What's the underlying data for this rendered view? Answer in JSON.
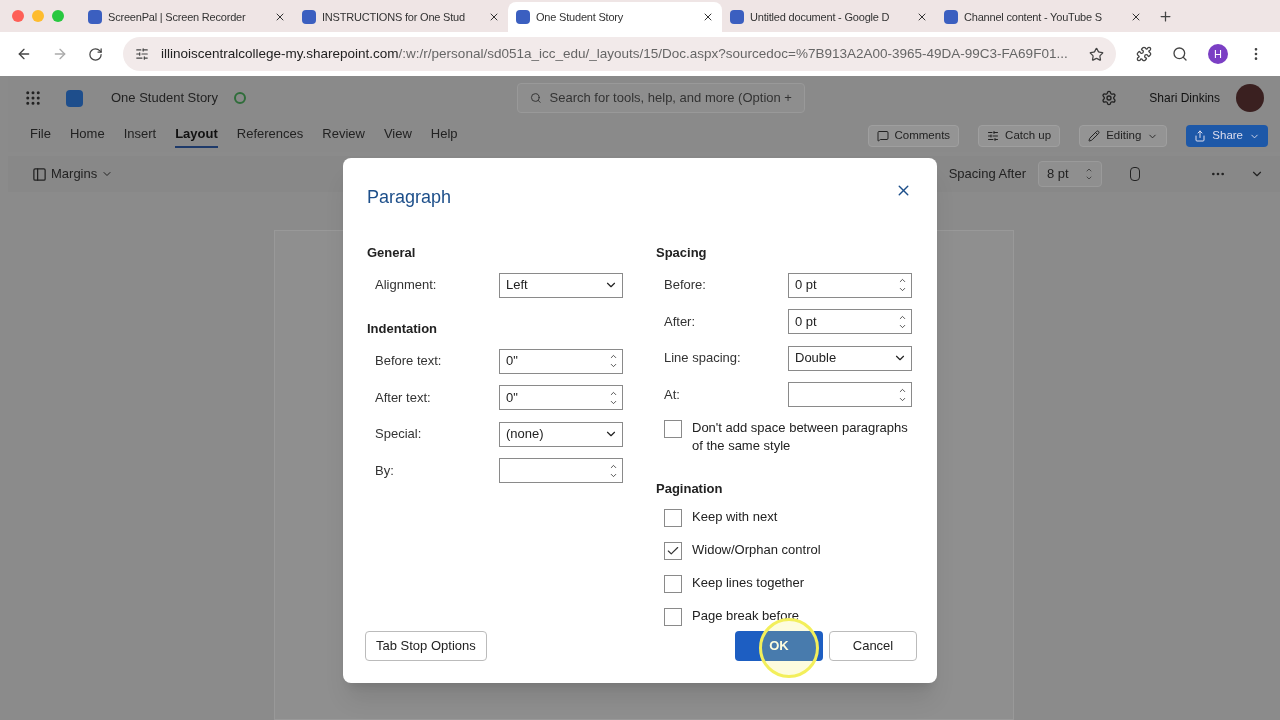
{
  "browser": {
    "tabs": [
      {
        "title": "ScreenPal | Screen Recorder",
        "selected": false
      },
      {
        "title": "INSTRUCTIONS for One Stud",
        "selected": false
      },
      {
        "title": "One Student Story",
        "selected": true
      },
      {
        "title": "Untitled document - Google D",
        "selected": false
      },
      {
        "title": "Channel content - YouTube S",
        "selected": false
      }
    ],
    "url_host": "illinoiscentralcollege-my.sharepoint.com",
    "url_path": "/:w:/r/personal/sd051a_icc_edu/_layouts/15/Doc.aspx?sourcedoc=%7B913A2A00-3965-49DA-99C3-FA69F01...",
    "profile_initial": "H"
  },
  "app": {
    "doc_title": "One Student Story",
    "search_placeholder": "Search for tools, help, and more (Option + ",
    "user": "Shari Dinkins",
    "menu": [
      {
        "label": "File",
        "selected": false
      },
      {
        "label": "Home",
        "selected": false
      },
      {
        "label": "Insert",
        "selected": false
      },
      {
        "label": "Layout",
        "selected": true
      },
      {
        "label": "References",
        "selected": false
      },
      {
        "label": "Review",
        "selected": false
      },
      {
        "label": "View",
        "selected": false
      },
      {
        "label": "Help",
        "selected": false
      }
    ],
    "actions": [
      "Comments",
      "Catch up",
      "Editing",
      "Share"
    ],
    "toolbar": {
      "margins": "Margins",
      "spacing_after_label": "Spacing After",
      "spacing_after_value": "8 pt"
    }
  },
  "dialog": {
    "title": "Paragraph",
    "left": [
      {
        "heading": "General",
        "fields": [
          {
            "label": "Alignment:",
            "kind": "dropdown",
            "value": "Left"
          }
        ]
      },
      {
        "heading": "Indentation",
        "fields": [
          {
            "label": "Before text:",
            "kind": "spin",
            "value": "0\""
          },
          {
            "label": "After text:",
            "kind": "spin",
            "value": "0\""
          },
          {
            "label": "Special:",
            "kind": "dropdown",
            "value": "(none)"
          },
          {
            "label": "By:",
            "kind": "spin"
          }
        ]
      }
    ],
    "right": [
      {
        "heading": "Spacing",
        "fields": [
          {
            "label": "Before:",
            "kind": "spin",
            "value": "0 pt"
          },
          {
            "label": "After:",
            "kind": "spin",
            "value": "0 pt"
          },
          {
            "label": "Line spacing:",
            "kind": "dropdown",
            "value": "Double"
          },
          {
            "label": "At:",
            "kind": "spin"
          }
        ],
        "checkboxes": [
          {
            "label": "Don't add space between paragraphs of the same style",
            "checked": false
          }
        ]
      },
      {
        "heading": "Pagination",
        "checkboxes": [
          {
            "label": "Keep with next",
            "checked": false
          },
          {
            "label": "Widow/Orphan control",
            "checked": true
          },
          {
            "label": "Keep lines together",
            "checked": false
          },
          {
            "label": "Page break before",
            "checked": false
          }
        ]
      }
    ],
    "tab_stop_button": "Tab Stop Options",
    "ok": "OK",
    "cancel": "Cancel"
  }
}
